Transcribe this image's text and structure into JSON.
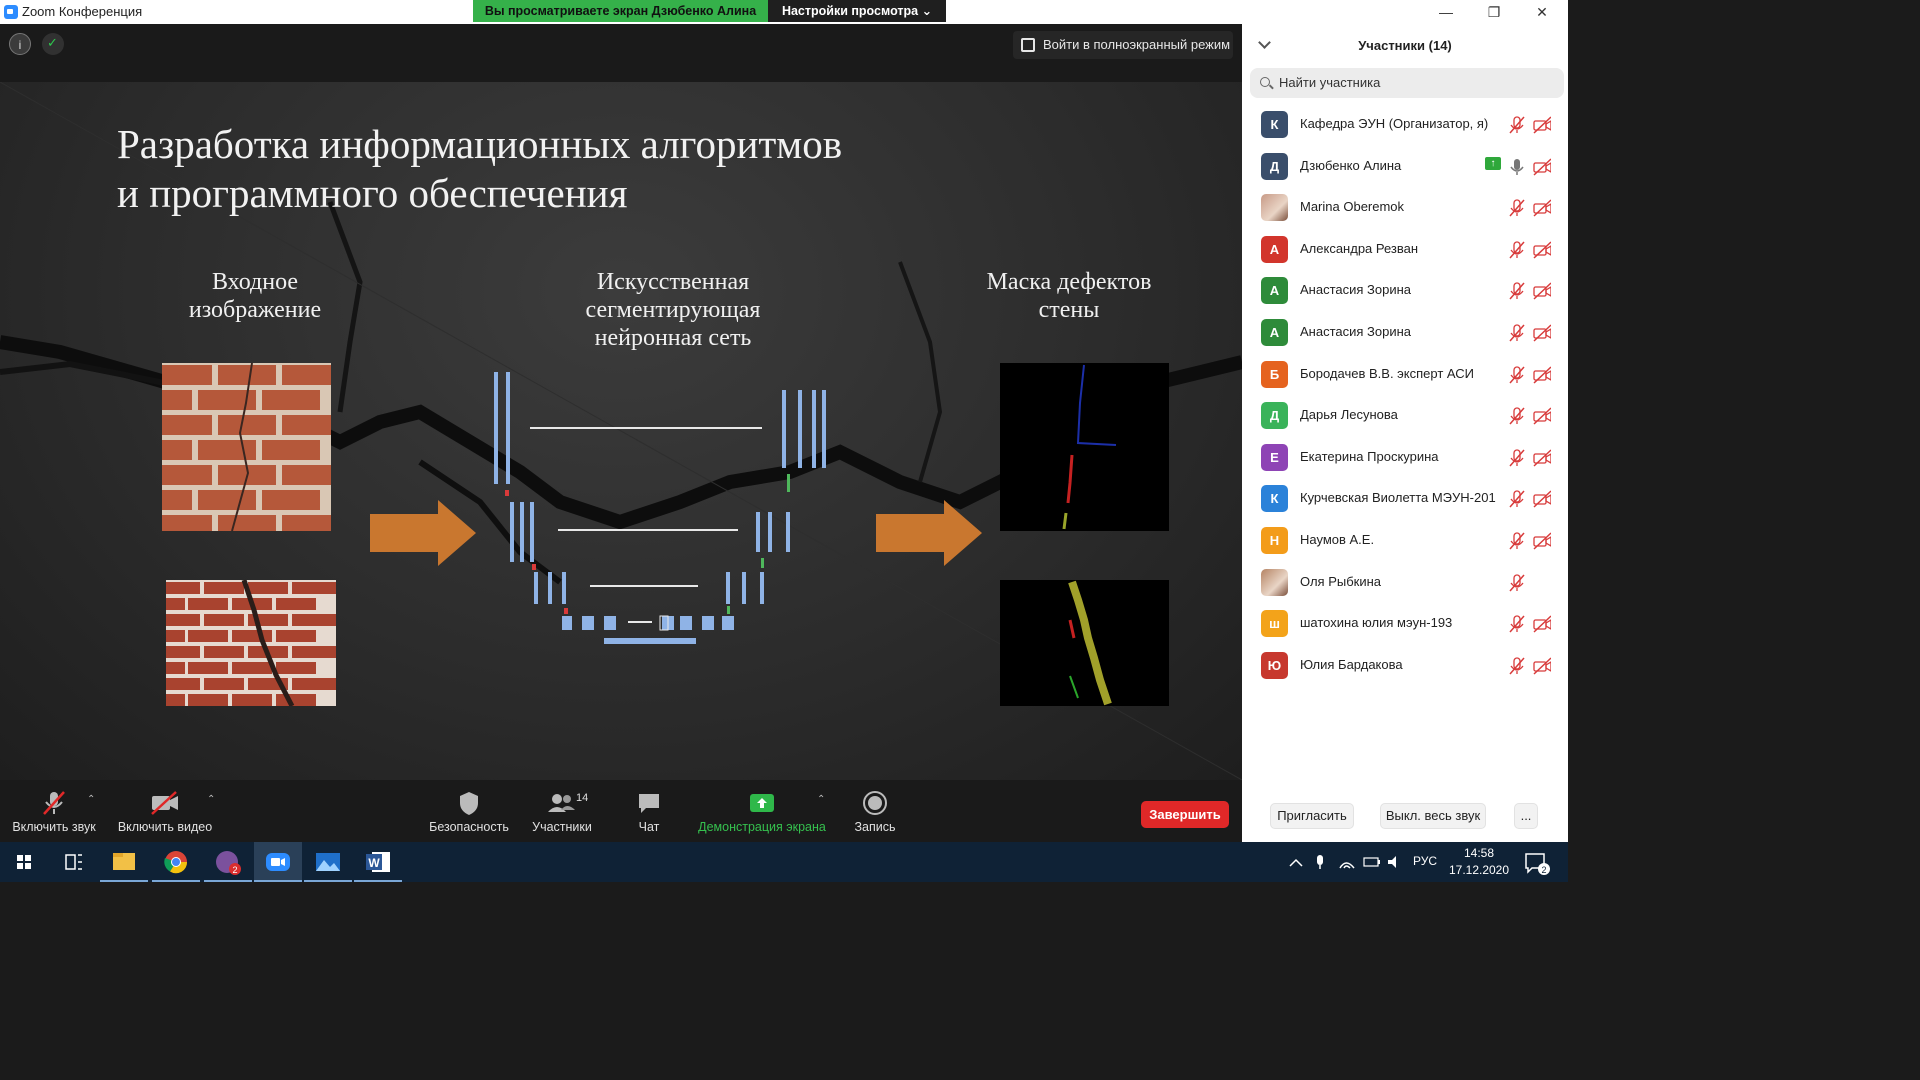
{
  "window": {
    "title": "Zoom Конференция",
    "share_banner": "Вы просматриваете экран Дзюбенко Алина",
    "view_options": "Настройки просмотра ⌄",
    "minimize": "—",
    "maximize": "❐",
    "close": "✕"
  },
  "meeting_top": {
    "info": "i",
    "fullscreen_label": "Войти в полноэкранный режим"
  },
  "slide": {
    "title_line1": "Разработка информационных алгоритмов",
    "title_line2": "и программного обеспечения",
    "col1_line1": "Входное",
    "col1_line2": "изображение",
    "col2_line1": "Искусственная",
    "col2_line2": "сегментирующая",
    "col2_line3": "нейронная сеть",
    "col3_line1": "Маска дефектов",
    "col3_line2": "стены",
    "arrow_color": "#c9772f"
  },
  "toolbar": {
    "audio": "Включить звук",
    "video": "Включить видео",
    "security": "Безопасность",
    "participants": "Участники",
    "participants_count": "14",
    "chat": "Чат",
    "share": "Демонстрация экрана",
    "record": "Запись",
    "end": "Завершить"
  },
  "panel": {
    "title": "Участники (14)",
    "search_placeholder": "Найти участника",
    "participants": [
      {
        "initial": "К",
        "name": "Кафедра ЭУН (Организатор, я)",
        "color": "#3a4e6b",
        "cam": true
      },
      {
        "initial": "Д",
        "name": "Дзюбенко Алина",
        "color": "#3a4e6b",
        "cam": true,
        "sharing": true,
        "mic_on": true
      },
      {
        "initial": "",
        "name": "Marina Oberemok",
        "color": "#c89a86",
        "cam": true,
        "photo": true
      },
      {
        "initial": "А",
        "name": "Александра Резван",
        "color": "#d2352c",
        "cam": true
      },
      {
        "initial": "А",
        "name": "Анастасия Зорина",
        "color": "#2e8b3a",
        "cam": true
      },
      {
        "initial": "А",
        "name": "Анастасия Зорина",
        "color": "#2e8b3a",
        "cam": true
      },
      {
        "initial": "Б",
        "name": "Бородачев В.В. эксперт АСИ",
        "color": "#e5631f",
        "cam": true
      },
      {
        "initial": "Д",
        "name": "Дарья Лесунова",
        "color": "#3ab35a",
        "cam": true
      },
      {
        "initial": "Е",
        "name": "Екатерина Проскурина",
        "color": "#8e44b5",
        "cam": true
      },
      {
        "initial": "К",
        "name": "Курчевская Виолетта МЭУН-201",
        "color": "#2b82d9",
        "cam": true
      },
      {
        "initial": "Н",
        "name": "Наумов А.Е.",
        "color": "#f39c1a",
        "cam": true
      },
      {
        "initial": "",
        "name": "Оля Рыбкина",
        "color": "#b58363",
        "cam": false,
        "photo": true
      },
      {
        "initial": "ш",
        "name": "шатохина юлия мэун-193",
        "color": "#f3a31a",
        "cam": true
      },
      {
        "initial": "Ю",
        "name": "Юлия Бардакова",
        "color": "#c7382e",
        "cam": true
      }
    ],
    "invite": "Пригласить",
    "mute_all": "Выкл. весь звук",
    "more": "..."
  },
  "taskbar": {
    "lang": "РУС",
    "time": "14:58",
    "date": "17.12.2020",
    "viber_badge": "2",
    "notif_badge": "2"
  }
}
